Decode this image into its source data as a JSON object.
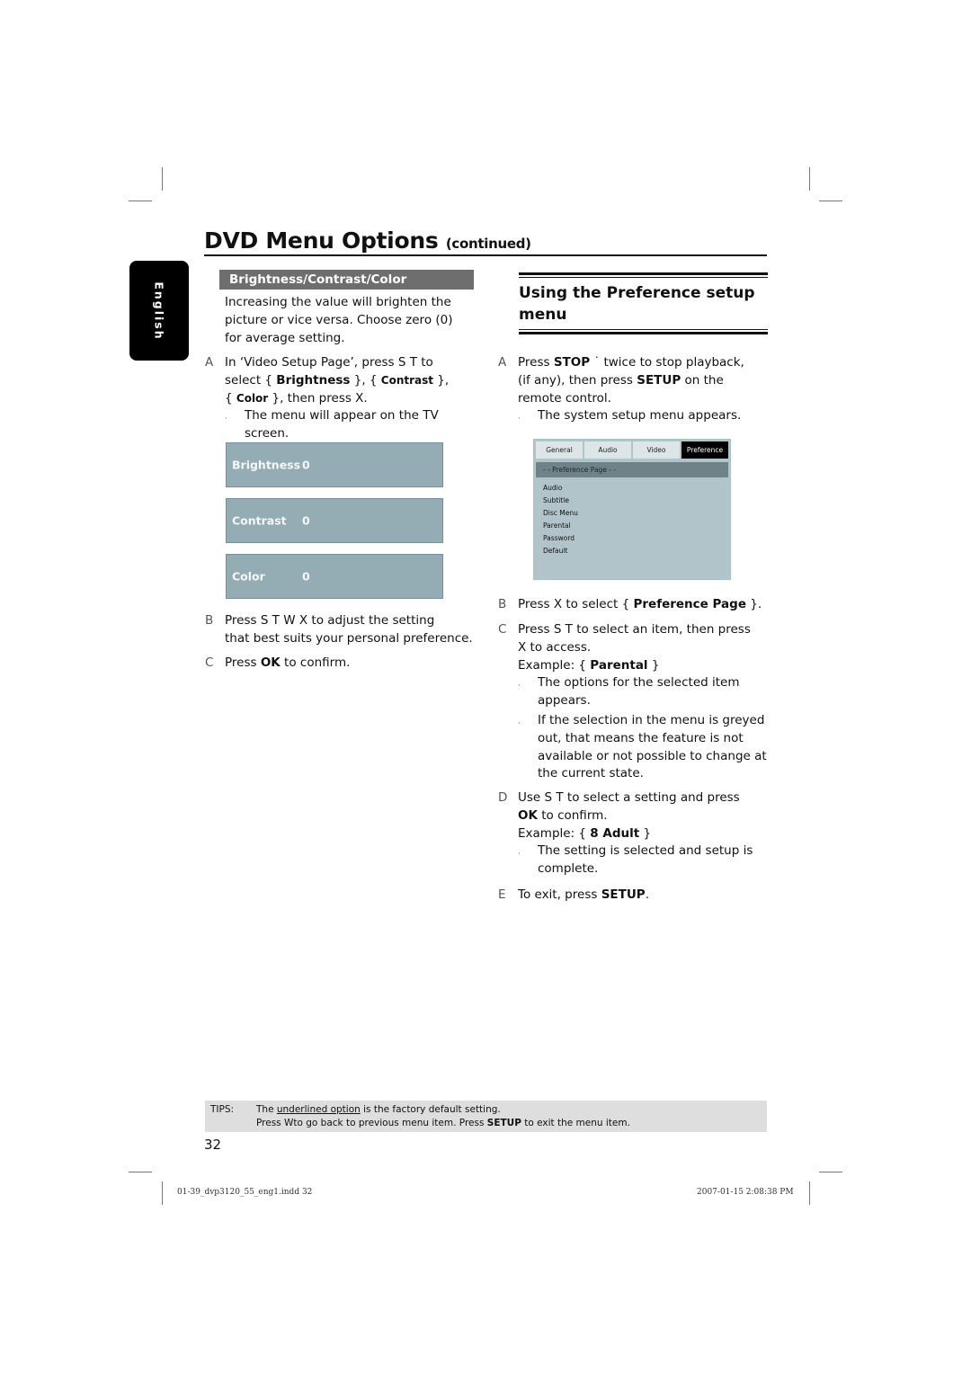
{
  "header": {
    "title": "DVD Menu Options",
    "title_suffix": "(continued)"
  },
  "language_tab": "English",
  "left": {
    "section_title": "Brightness/Contrast/Color",
    "intro": [
      "Increasing the value will brighten the",
      "picture or vice versa. Choose zero (0)",
      "for average setting."
    ],
    "step_a": {
      "letter": "A",
      "line1_pre": "In ‘Video Setup Page’, press  S  T  to",
      "line2_pre": "select { ",
      "line2_b1": "Brightness",
      "line2_mid": " }, { ",
      "line2_b2": "Contrast",
      "line2_post": " },",
      "line3_pre": "{ ",
      "line3_b": "Color",
      "line3_post": " }, then press  X.",
      "result_lines": [
        "The menu will appear on the TV",
        "screen."
      ]
    },
    "osd_items": [
      {
        "label": "Brightness",
        "value": "0"
      },
      {
        "label": "Contrast",
        "value": "0"
      },
      {
        "label": "Color",
        "value": "0"
      }
    ],
    "step_b": {
      "letter": "B",
      "lines": [
        "Press  S  T  W X to adjust the setting",
        "that best suits your personal preference."
      ]
    },
    "step_c": {
      "letter": "C",
      "pre": "Press ",
      "bold": "OK",
      "post": " to confirm."
    }
  },
  "right": {
    "section_title_lines": [
      "Using the Preference setup",
      "menu"
    ],
    "step_a": {
      "letter": "A",
      "l1_pre": "Press ",
      "l1_b": "STOP",
      "l1_post": " ˙     twice to stop playback,",
      "l2_pre": "(if any), then press ",
      "l2_b": "SETUP",
      "l2_post": " on the",
      "l3": "remote control.",
      "result": "The system setup menu appears."
    },
    "setup_menu": {
      "tabs": [
        {
          "label": "General",
          "active": false
        },
        {
          "label": "Audio",
          "active": false
        },
        {
          "label": "Video",
          "active": false
        },
        {
          "label": "Preference",
          "active": true
        }
      ],
      "page_title": "- -   Preference Page   - -",
      "items": [
        "Audio",
        "Subtitle",
        "Disc Menu",
        "Parental",
        "Password",
        "Default"
      ]
    },
    "step_b": {
      "letter": "B",
      "pre": "Press  X to select { ",
      "bold": "Preference Page",
      "post": " }."
    },
    "step_c": {
      "letter": "C",
      "l1": "Press  S  T  to select an item, then press",
      "l2": " X to access.",
      "example_pre": "Example: { ",
      "example_b": "Parental",
      "example_post": " }",
      "result1": [
        "The options for the selected item",
        "appears."
      ],
      "result2": [
        "If the selection in the menu is greyed",
        "out, that means the feature is not",
        "available or not possible to change at",
        "the current state."
      ]
    },
    "step_d": {
      "letter": "D",
      "l1": "Use  S  T  to select a setting and press",
      "l2_b": "OK",
      "l2_post": " to confirm.",
      "example_pre": "Example: { ",
      "example_b": "8 Adult",
      "example_post": " }",
      "result": [
        "The setting is selected and setup is",
        "complete."
      ]
    },
    "step_e": {
      "letter": "E",
      "pre": "To exit, press ",
      "bold": "SETUP",
      "post": "."
    }
  },
  "tips": {
    "label": "TIPS:",
    "l1_pre": "The ",
    "l1_u": "underlined option",
    "l1_post": " is the factory default setting.",
    "l2_pre": "Press   Wto go back to previous menu item. Press ",
    "l2_b": "SETUP",
    "l2_post": " to exit the menu item."
  },
  "page_number": "32",
  "footer": {
    "file": "01-39_dvp3120_55_eng1.indd   32",
    "timestamp": "2007-01-15   2:08:38 PM"
  }
}
